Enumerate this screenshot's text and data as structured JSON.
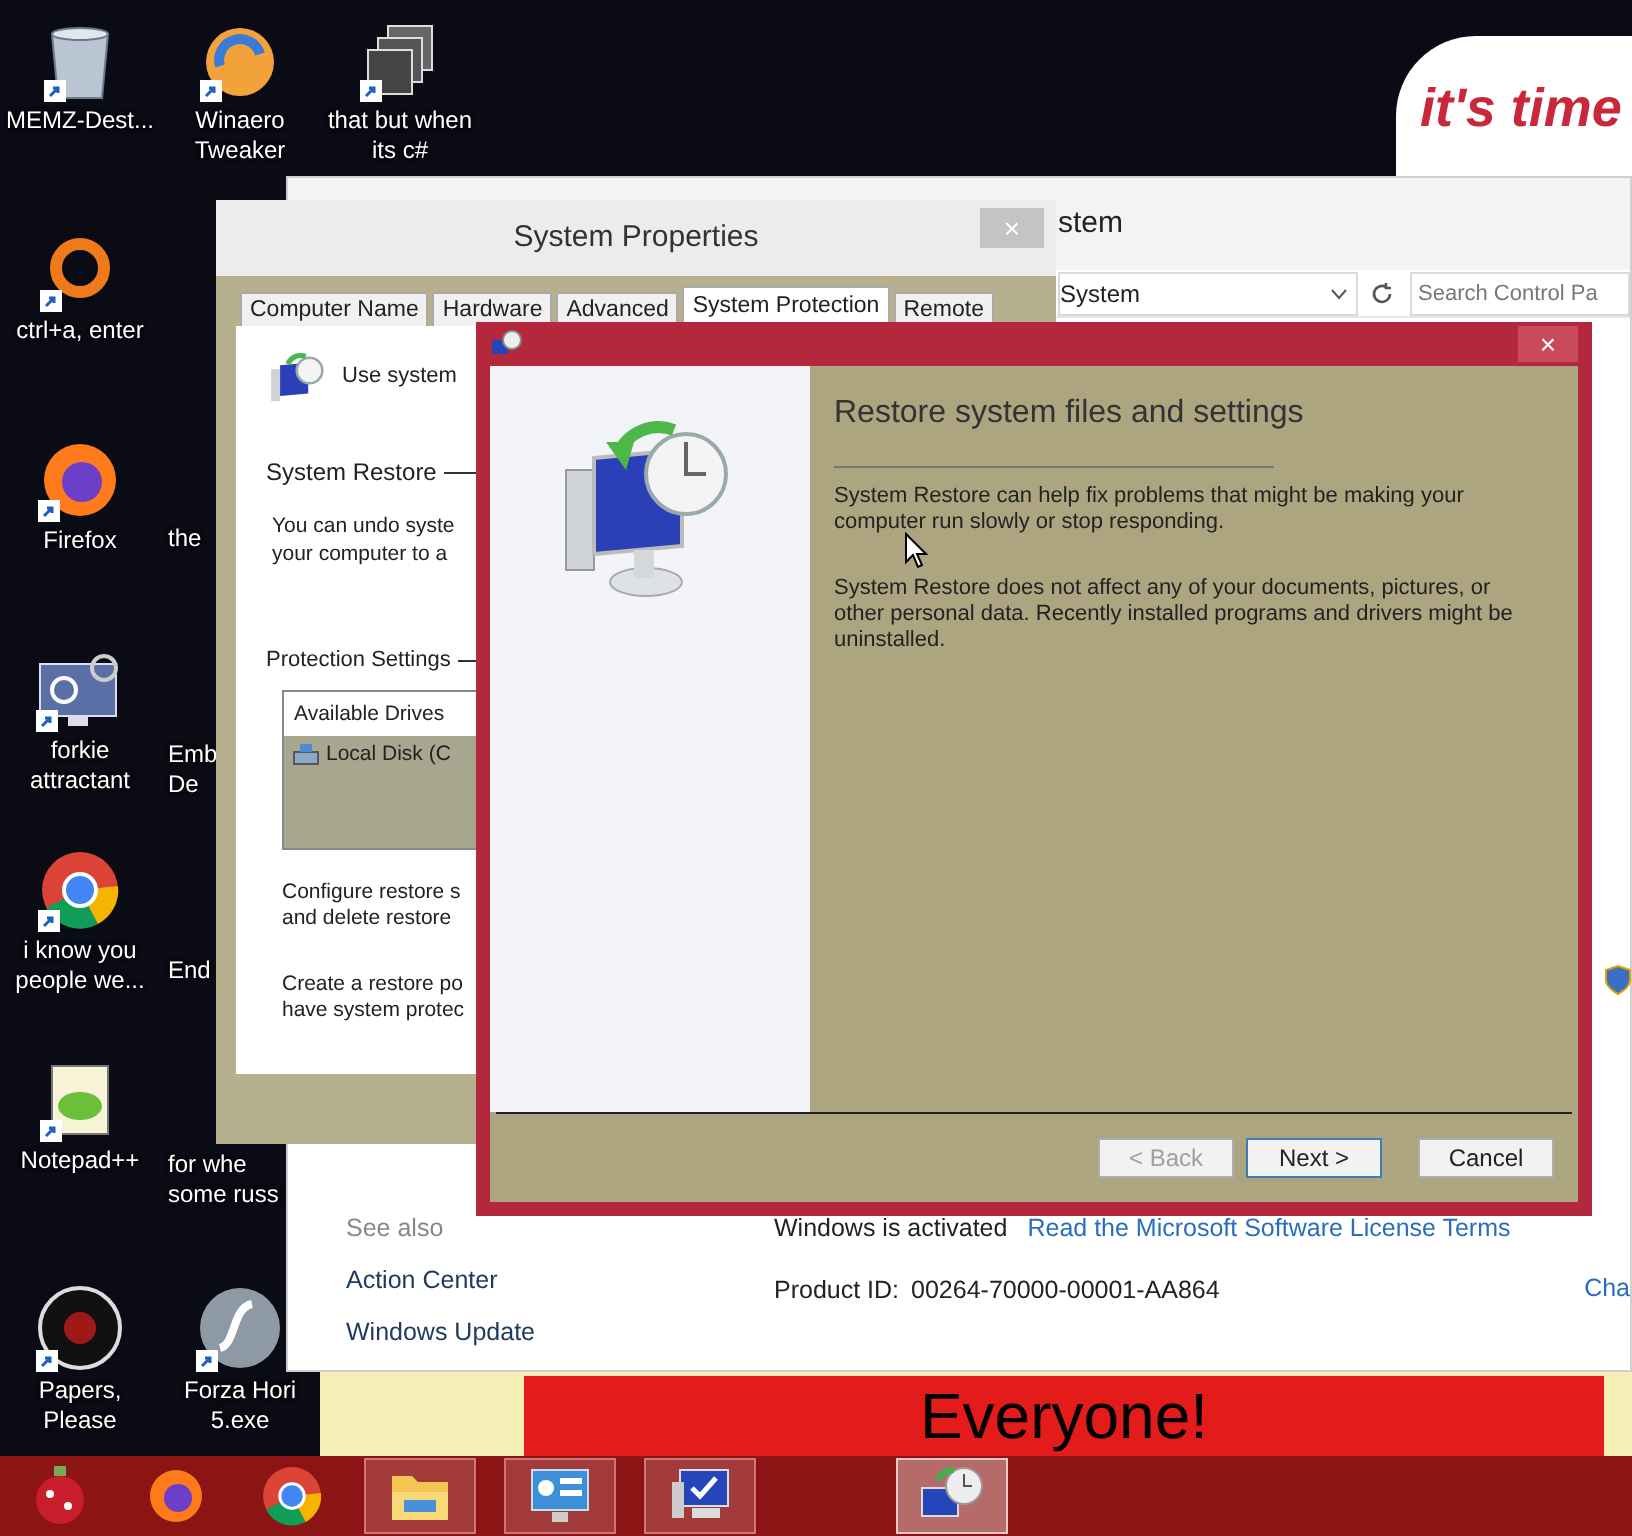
{
  "desktop_icons": [
    {
      "label": "MEMZ-Dest...",
      "kind": "bin"
    },
    {
      "label": "Winaero Tweaker",
      "kind": "swirl"
    },
    {
      "label": "that but when its c#",
      "kind": "stack"
    },
    {
      "label": "ctrl+a, enter",
      "kind": "ring"
    },
    {
      "label": "Firefox",
      "kind": "fox"
    },
    {
      "label": "the",
      "kind": "partial"
    },
    {
      "label": "forkie attractant",
      "kind": "gear"
    },
    {
      "label": "Emb\nDe",
      "kind": "partial"
    },
    {
      "label": "i know you people we...",
      "kind": "chrome"
    },
    {
      "label": "End",
      "kind": "partial"
    },
    {
      "label": "Notepad++",
      "kind": "notepad"
    },
    {
      "label": "for whe\nsome russ",
      "kind": "partial"
    },
    {
      "label": "Papers, Please",
      "kind": "seal"
    },
    {
      "label": "Forza Hori\n5.exe",
      "kind": "flash"
    }
  ],
  "wallpaper": {
    "bubble_text": "it's time",
    "banner_text": "Everyone!"
  },
  "control_panel": {
    "title": "stem",
    "address": "System",
    "search_placeholder": "Search Control Pa",
    "see_also": {
      "heading": "See also",
      "links": [
        "Action Center",
        "Windows Update"
      ]
    },
    "activation_status": "Windows is activated",
    "license_link": "Read the Microsoft Software License Terms",
    "product_id_label": "Product ID:",
    "product_id": "00264-70000-00001-AA864",
    "cut_link": "Cha"
  },
  "system_properties": {
    "title": "System Properties",
    "close": "×",
    "tabs": [
      {
        "label": "Computer Name",
        "selected": false
      },
      {
        "label": "Hardware",
        "selected": false
      },
      {
        "label": "Advanced",
        "selected": false
      },
      {
        "label": "System Protection",
        "selected": true
      },
      {
        "label": "Remote",
        "selected": false
      }
    ],
    "intro": "Use system",
    "restore_group": "System Restore",
    "restore_text": "You can undo syste\nyour computer to a",
    "protection_group": "Protection Settings",
    "drives_header": "Available Drives",
    "drive": "Local Disk (C",
    "configure_text": "Configure restore s\nand delete restore",
    "create_text": "Create a restore po\nhave system protec"
  },
  "wizard": {
    "close": "×",
    "heading": "Restore system files and settings",
    "paragraphs": [
      "System Restore can help fix problems that might be making your computer run slowly or stop responding.",
      "System Restore does not affect any of your documents, pictures, or other personal data. Recently installed programs and drivers might be uninstalled."
    ],
    "buttons": [
      {
        "label": "< Back",
        "disabled": true,
        "default": false
      },
      {
        "label": "Next >",
        "disabled": false,
        "default": true
      },
      {
        "label": "Cancel",
        "disabled": false,
        "default": false
      }
    ]
  },
  "taskbar": [
    {
      "kind": "ornament",
      "running": false,
      "selected": false
    },
    {
      "kind": "firefox",
      "running": false,
      "selected": false
    },
    {
      "kind": "chrome",
      "running": false,
      "selected": false
    },
    {
      "kind": "explorer",
      "running": true,
      "selected": false
    },
    {
      "kind": "control-panel",
      "running": true,
      "selected": false
    },
    {
      "kind": "computer",
      "running": true,
      "selected": false
    },
    {
      "kind": "restore",
      "running": true,
      "selected": true
    }
  ]
}
